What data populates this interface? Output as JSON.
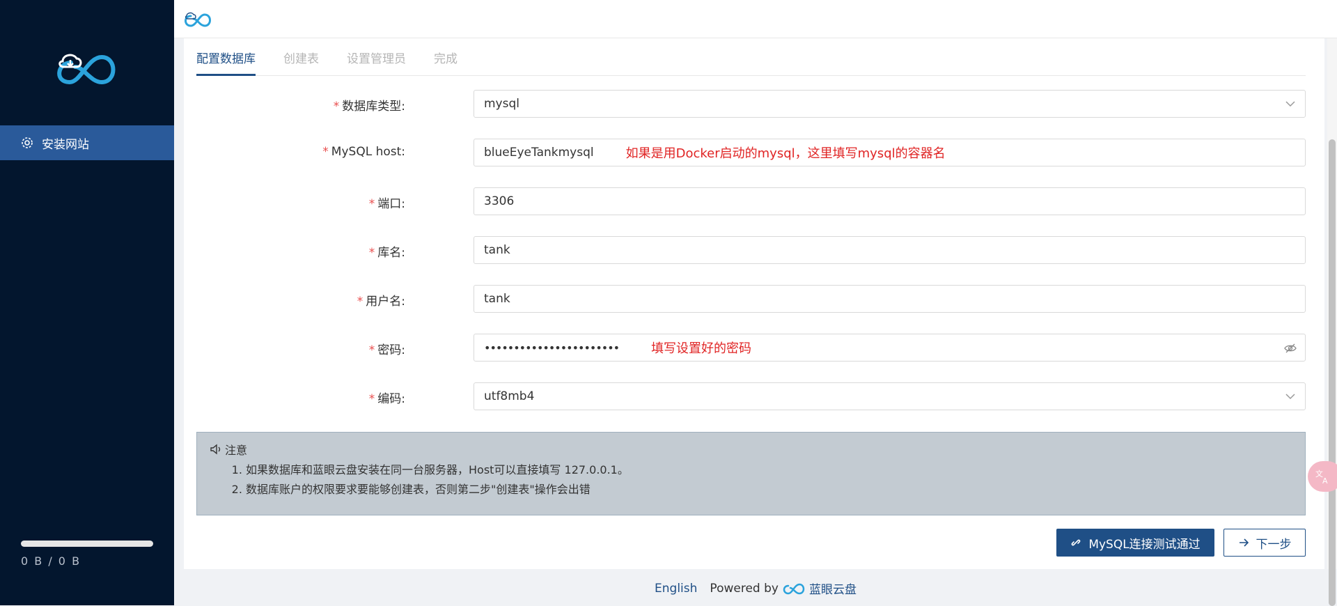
{
  "sidebar": {
    "menu_item_label": "安装网站",
    "usage_fraction": 1.0,
    "usage_text": "0 B / 0 B"
  },
  "steps": [
    "配置数据库",
    "创建表",
    "设置管理员",
    "完成"
  ],
  "form": {
    "db_type": {
      "label": "数据库类型:",
      "value": "mysql"
    },
    "host": {
      "label": "MySQL host:",
      "value": "blueEyeTankmysql",
      "hint": "如果是用Docker启动的mysql，这里填写mysql的容器名"
    },
    "port": {
      "label": "端口:",
      "value": "3306"
    },
    "db_name": {
      "label": "库名:",
      "value": "tank"
    },
    "username": {
      "label": "用户名:",
      "value": "tank"
    },
    "password": {
      "label": "密码:",
      "value": "•••••••••••••••••••••••",
      "hint": "填写设置好的密码"
    },
    "charset": {
      "label": "编码:",
      "value": "utf8mb4"
    },
    "required_mark": "*"
  },
  "notice": {
    "title": "注意",
    "items": [
      "如果数据库和蓝眼云盘安装在同一台服务器，Host可以直接填写 127.0.0.1。",
      "数据库账户的权限要求要能够创建表，否则第二步\"创建表\"操作会出错"
    ]
  },
  "buttons": {
    "test_connection": "MySQL连接测试通过",
    "next": "下一步"
  },
  "footer": {
    "language": "English",
    "powered_by": "Powered by",
    "brand": "蓝眼云盘"
  },
  "colors": {
    "sidebar_bg": "#03162e",
    "accent": "#1f4f86",
    "hint_red": "#e02424"
  }
}
